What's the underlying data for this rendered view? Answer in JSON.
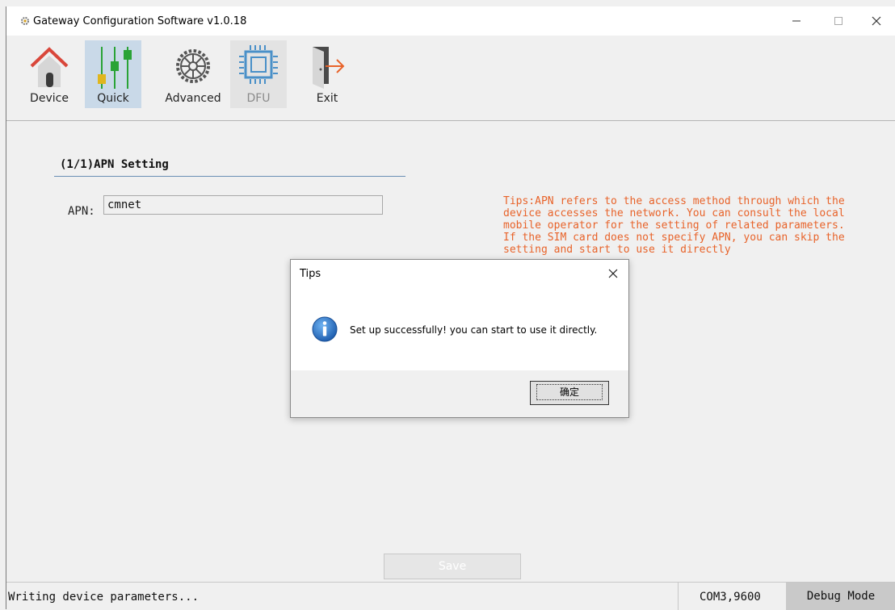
{
  "window": {
    "title": "Gateway Configuration Software v1.0.18",
    "controls": {
      "minimize": "—",
      "maximize": "□",
      "close": "✕"
    }
  },
  "toolbar": {
    "items": [
      {
        "label": "Device",
        "icon": "house-icon",
        "state": "normal"
      },
      {
        "label": "Quick",
        "icon": "sliders-icon",
        "state": "active"
      },
      {
        "label": "Advanced",
        "icon": "gear-icon",
        "state": "normal"
      },
      {
        "label": "DFU",
        "icon": "chip-icon",
        "state": "disabled"
      },
      {
        "label": "Exit",
        "icon": "exit-door-icon",
        "state": "normal"
      }
    ]
  },
  "content": {
    "section_title": "(1/1)APN Setting",
    "apn_label": "APN:",
    "apn_value": "cmnet",
    "tips": "Tips:APN refers to the access method through which the device accesses the network. You can consult the local mobile operator for the setting of related parameters.  If the SIM card does not specify APN, you can  skip the setting and start to use it directly",
    "save_label": "Save"
  },
  "dialog": {
    "title": "Tips",
    "message": "Set up successfully! you can start to use it directly.",
    "ok_label": "确定",
    "icon": "info-icon"
  },
  "statusbar": {
    "message": "Writing device parameters...",
    "port": "COM3,9600",
    "mode": "Debug Mode"
  },
  "colors": {
    "accent": "#2f7fd0",
    "tips_text": "#e8632a",
    "active_tool": "#c9d9e8",
    "house_roof": "#d9473b",
    "slider_yellow": "#e0b61e",
    "slider_green": "#2aa336"
  }
}
